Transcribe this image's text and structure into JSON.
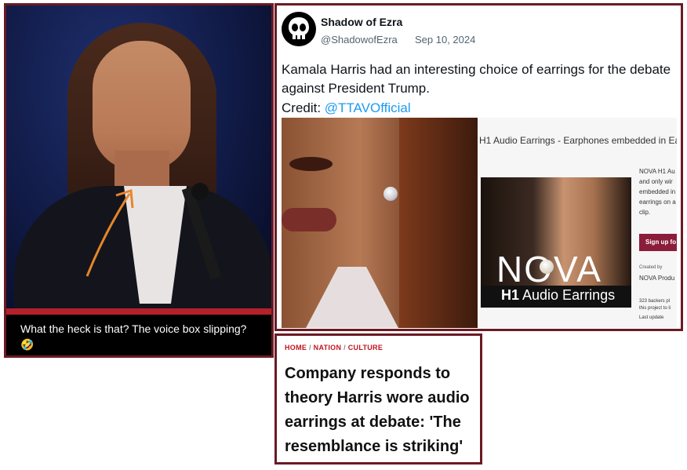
{
  "left_panel": {
    "caption": "What the heck is that? The voice box slipping?",
    "caption_emoji": "🤣"
  },
  "tweet": {
    "display_name": "Shadow of Ezra",
    "handle": "@ShadowofEzra",
    "date": "Sep 10, 2024",
    "text": "Kamala Harris had an interesting choice of earrings for the debate against President Trump.",
    "credit_label": "Credit: ",
    "credit_link": "@TTAVOfficial"
  },
  "product": {
    "title": "H1 Audio Earrings - Earphones embedded in Ea",
    "logo": "NOVA",
    "sub_bold": "H1",
    "sub": " Audio Earrings",
    "desc": "NOVA H1 Au and only wir embedded in earrings on a clip.",
    "signup": "Sign up fo",
    "created_by": "Created by",
    "creator": "NOVA Produ",
    "backers": "323 backers pl this project to li",
    "last_update": "Last update"
  },
  "headline": {
    "crumbs": [
      "HOME",
      "NATION",
      "CULTURE"
    ],
    "separator": "/",
    "title": "Company responds to theory Harris wore audio earrings at debate: 'The resemblance is striking'"
  },
  "colors": {
    "frame": "#6b1a24",
    "link": "#1d9bf0",
    "breadcrumb": "#c0141e",
    "arrow": "#e8852a"
  }
}
